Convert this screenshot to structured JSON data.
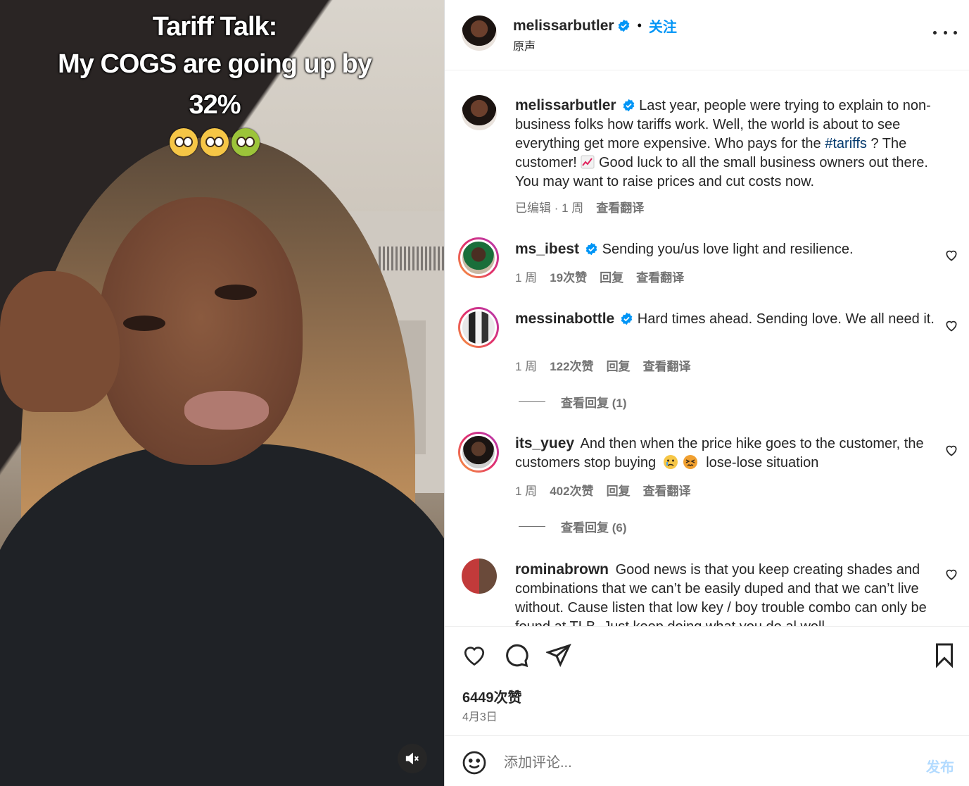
{
  "video": {
    "caption_line1": "Tariff Talk:",
    "caption_line2": "My COGS are going up by 32%",
    "emojis": [
      "flushed-face",
      "pleading-face",
      "vomiting-face"
    ]
  },
  "header": {
    "username": "melissarbutler",
    "follow_label": "关注",
    "audio_label": "原声"
  },
  "post": {
    "username": "melissarbutler",
    "text_before_tag": "Last year, people were trying to explain to non-business folks how tariffs work. Well, the world is about to see everything get more expensive. Who pays for the",
    "hashtag": "#tariffs",
    "text_after_tag": "? The customer!",
    "text_end": "Good luck to all the small business owners out there. You may want to raise prices and cut costs now.",
    "edited": "已编辑 · 1 周",
    "translate": "查看翻译"
  },
  "comments": [
    {
      "username": "ms_ibest",
      "text": "Sending you/us love light and resilience.",
      "time": "1 周",
      "likes": "19次赞",
      "reply": "回复",
      "translate": "查看翻译"
    },
    {
      "username": "messinabottle",
      "text": "Hard times ahead. Sending love. We all need it.",
      "time": "1 周",
      "likes": "122次赞",
      "reply": "回复",
      "translate": "查看翻译",
      "view_replies": "查看回复 (1)"
    },
    {
      "username": "its_yuey",
      "text_a": "And then when the price hike goes to the customer, the customers stop buying",
      "text_b": "lose-lose situation",
      "time": "1 周",
      "likes": "402次赞",
      "reply": "回复",
      "translate": "查看翻译",
      "view_replies": "查看回复 (6)"
    },
    {
      "username": "rominabrown",
      "text": "Good news is that you keep creating shades and combinations that we can’t be easily duped and that we can’t live without. Cause listen that low key / boy trouble combo can only be found at TLB. Just keep doing what you do al well"
    }
  ],
  "footer": {
    "likes_count": "6449次赞",
    "date": "4月3日",
    "comment_placeholder": "添加评论...",
    "post_label": "发布"
  },
  "colors": {
    "accent": "#0095f6",
    "verified": "#0095f6",
    "hashtag": "#00376b",
    "muted_text": "#737373",
    "post_disabled": "#b3dbff"
  }
}
